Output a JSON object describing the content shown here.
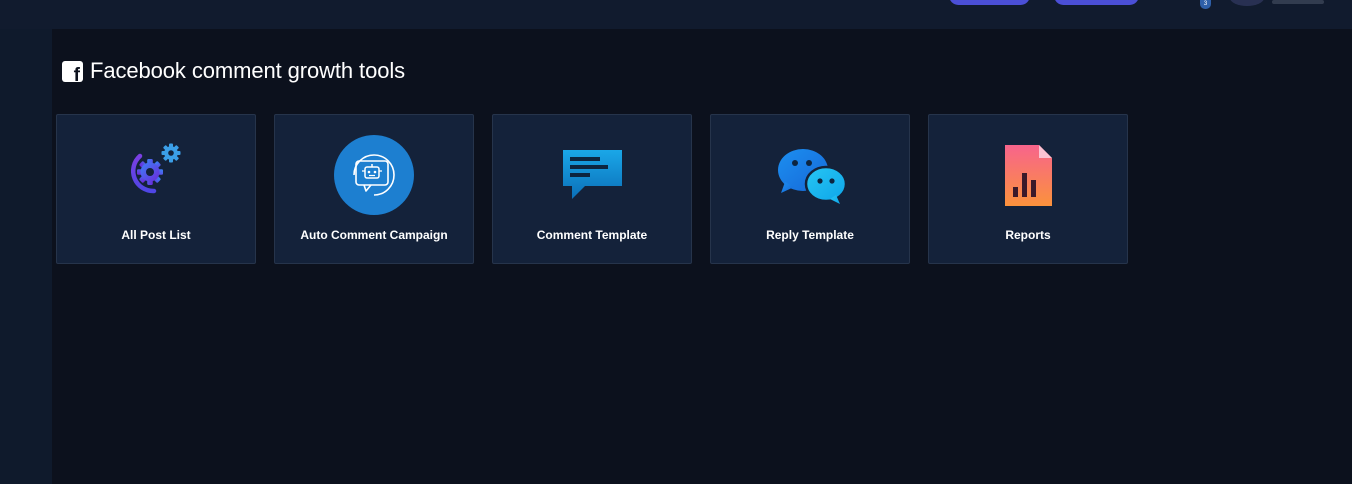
{
  "header": {
    "notification_count": "3"
  },
  "page": {
    "title": "Facebook comment growth tools",
    "title_icon": "facebook-square-icon"
  },
  "cards": [
    {
      "label": "All Post List",
      "icon": "gears-icon"
    },
    {
      "label": "Auto Comment Campaign",
      "icon": "robot-comment-icon"
    },
    {
      "label": "Comment Template",
      "icon": "message-square-icon"
    },
    {
      "label": "Reply Template",
      "icon": "chat-bubbles-icon"
    },
    {
      "label": "Reports",
      "icon": "report-document-icon"
    }
  ],
  "colors": {
    "background": "#0c111d",
    "card_background": "#14223a",
    "card_border": "#26344b",
    "accent_purple": "#4b4fd6"
  }
}
